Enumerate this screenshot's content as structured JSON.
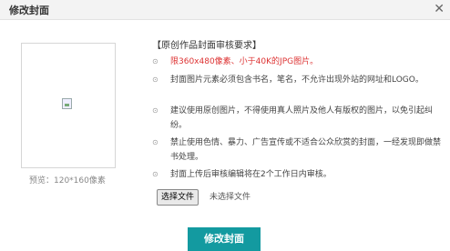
{
  "dialog": {
    "title": "修改封面",
    "close_glyph": "✕"
  },
  "preview": {
    "caption": "预览：120*160像素",
    "placeholder_icon": "broken-image-icon"
  },
  "requirements": {
    "heading": "【原创作品封面审核要求】",
    "bullet_glyph": "⊙",
    "items": [
      "限360x480像素、小于40K的JPG图片。",
      "封面图片元素必须包含书名，笔名，不允许出现外站的网址和LOGO。",
      "建议使用原创图片，不得使用真人照片及他人有版权的图片，以免引起纠纷。",
      "禁止使用色情、暴力、广告宣传或不适合公众欣赏的封面，一经发现即做禁书处理。",
      "封面上传后审核编辑将在2个工作日内审核。"
    ],
    "highlight_color": "#dd3333"
  },
  "file_input": {
    "button_label": "选择文件",
    "status": "未选择文件"
  },
  "submit_button": {
    "label": "修改封面",
    "color": "#139aa0"
  }
}
